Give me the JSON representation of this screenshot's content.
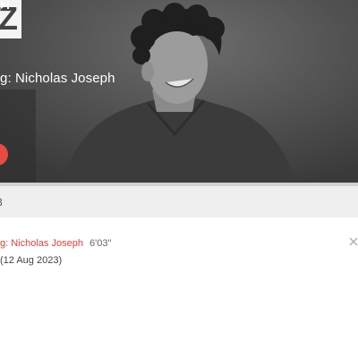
{
  "header": {
    "logo_letter": "Z",
    "now_playing": "g: Nicholas Joseph"
  },
  "player": {
    "play_icon": "play-icon",
    "next_icon": "next-icon",
    "progress_fraction": 0.0
  },
  "subbar": {
    "text": "3"
  },
  "track": {
    "title": "g: Nicholas Joseph",
    "duration": "6'03\"",
    "date": "(12 Aug 2023)",
    "close_icon": "close-icon"
  },
  "colors": {
    "accent": "#e74b43",
    "link_red": "#d9423b",
    "hero_bg": "#4a4a4a"
  }
}
